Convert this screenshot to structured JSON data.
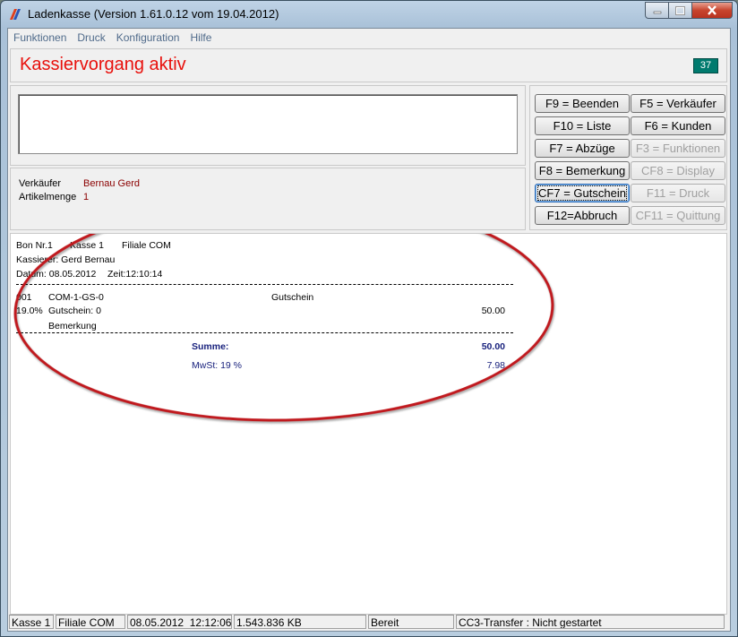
{
  "window": {
    "title": "Ladenkasse (Version 1.61.0.12 vom 19.04.2012)"
  },
  "menu": [
    "Funktionen",
    "Druck",
    "Konfiguration",
    "Hilfe"
  ],
  "header": {
    "status": "Kassiervorgang aktiv",
    "counter": "37"
  },
  "info": {
    "seller_label": "Verkäufer",
    "seller_value": "Bernau Gerd",
    "qty_label": "Artikelmenge",
    "qty_value": "1"
  },
  "buttons": [
    {
      "label": "F9 = Beenden",
      "enabled": true
    },
    {
      "label": "F5 = Verkäufer",
      "enabled": true
    },
    {
      "label": "F10 = Liste",
      "enabled": true
    },
    {
      "label": "F6 = Kunden",
      "enabled": true
    },
    {
      "label": "F7 = Abzüge",
      "enabled": true
    },
    {
      "label": "F3 = Funktionen",
      "enabled": false
    },
    {
      "label": "F8 = Bemerkung",
      "enabled": true
    },
    {
      "label": "CF8 = Display",
      "enabled": false
    },
    {
      "label": "CF7 = Gutschein",
      "enabled": true
    },
    {
      "label": "F11 = Druck",
      "enabled": false
    },
    {
      "label": "F12=Abbruch",
      "enabled": true
    },
    {
      "label": "CF11 = Quittung",
      "enabled": false
    }
  ],
  "receipt": {
    "bon": "Bon Nr.1",
    "kasse": "Kasse 1",
    "filiale": "Filiale COM",
    "kassierer": "Kassierer: Gerd Bernau",
    "datum": "Datum: 08.05.2012",
    "zeit": "Zeit:12:10:14",
    "item_no": "001",
    "item_code": "COM-1-GS-0",
    "item_type": "Gutschein",
    "vat_rate": "19.0%",
    "item_desc": "Gutschein: 0",
    "item_amount": "50.00",
    "remark": "Bemerkung",
    "sum_label": "Summe:",
    "sum_value": "50.00",
    "vat_label": "MwSt: 19 %",
    "vat_value": "7.98"
  },
  "statusbar": [
    "Kasse 1",
    "Filiale COM",
    "08.05.2012",
    "12:12:06",
    "1.543.836 KB",
    "Bereit",
    "CC3-Transfer : Nicht gestartet"
  ],
  "colors": {
    "status_red": "#e8100c",
    "counter_bg": "#007a6e",
    "annotation": "#c0191e",
    "receipt_blue": "#1a237e"
  }
}
